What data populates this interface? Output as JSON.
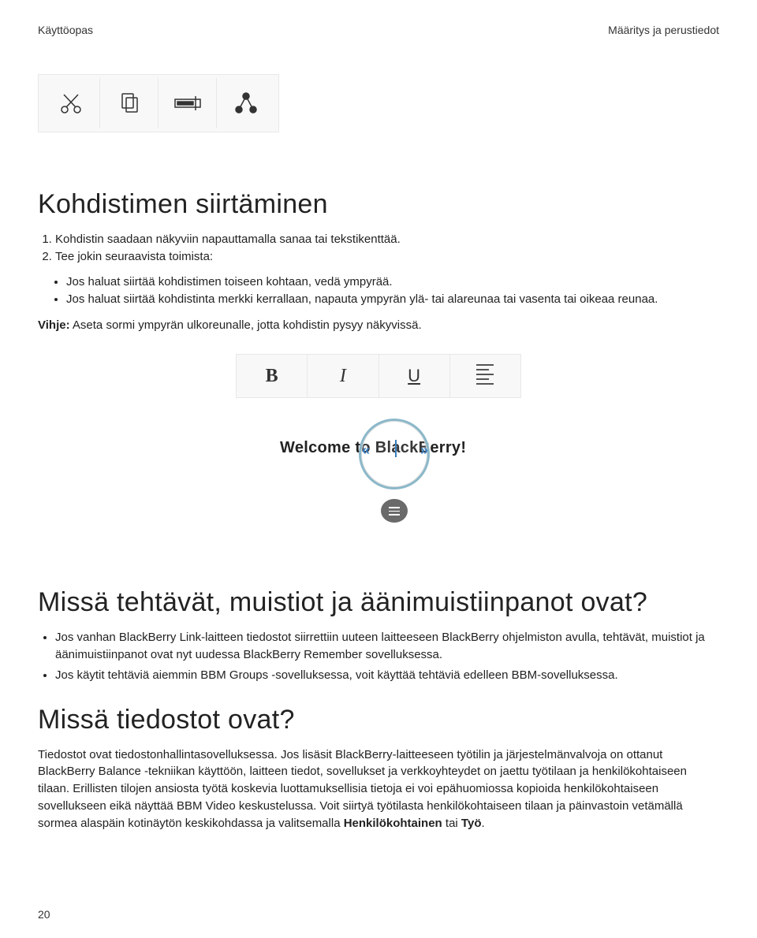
{
  "header": {
    "left": "Käyttöopas",
    "right": "Määritys ja perustiedot"
  },
  "toolbar1_icons": [
    "cut-icon",
    "copy-icon",
    "paste-icon",
    "share-icon"
  ],
  "section1": {
    "title": "Kohdistimen siirtäminen",
    "steps": [
      "Kohdistin saadaan näkyviin napauttamalla sanaa tai tekstikenttää.",
      "Tee jokin seuraavista toimista:"
    ],
    "substeps": [
      "Jos haluat siirtää kohdistimen toiseen kohtaan, vedä ympyrää.",
      "Jos haluat siirtää kohdistinta merkki kerrallaan, napauta ympyrän ylä- tai alareunaa tai vasenta tai oikeaa reunaa."
    ],
    "hint_label": "Vihje:",
    "hint_text": " Aseta sormi ympyrän ulkoreunalle, jotta kohdistin pysyy näkyvissä."
  },
  "figure2": {
    "format_buttons": {
      "bold": "B",
      "italic": "I",
      "underline": "U"
    },
    "welcome_text": "Welcome to BlackBerry!"
  },
  "section2": {
    "title": "Missä tehtävät, muistiot ja äänimuistiinpanot ovat?",
    "bullets": [
      "Jos vanhan BlackBerry Link-laitteen tiedostot siirrettiin uuteen laitteeseen BlackBerry ohjelmiston avulla, tehtävät, muistiot ja äänimuistiinpanot ovat nyt uudessa BlackBerry Remember sovelluksessa.",
      "Jos käytit tehtäviä aiemmin BBM Groups -sovelluksessa, voit käyttää tehtäviä edelleen BBM-sovelluksessa."
    ]
  },
  "section3": {
    "title": "Missä tiedostot ovat?",
    "para_pre": "Tiedostot ovat tiedostonhallintasovelluksessa. Jos lisäsit BlackBerry-laitteeseen työtilin ja järjestelmänvalvoja on ottanut BlackBerry Balance -tekniikan käyttöön, laitteen tiedot, sovellukset ja verkkoyhteydet on jaettu työtilaan ja henkilökohtaiseen tilaan. Erillisten tilojen ansiosta työtä koskevia luottamuksellisia tietoja ei voi epähuomiossa kopioida henkilökohtaiseen sovellukseen eikä näyttää BBM Video keskustelussa. Voit siirtyä työtilasta henkilökohtaiseen tilaan ja päinvastoin vetämällä sormea alaspäin kotinäytön keskikohdassa ja valitsemalla ",
    "bold1": "Henkilökohtainen",
    "mid": " tai ",
    "bold2": "Työ",
    "end": "."
  },
  "page_number": "20"
}
